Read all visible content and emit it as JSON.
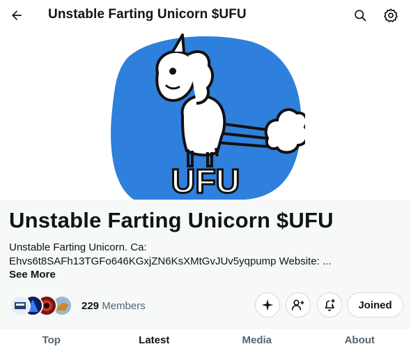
{
  "header": {
    "title": "Unstable Farting Unicorn $UFU",
    "icons": [
      "arrow-left-icon",
      "search-icon",
      "gear-icon"
    ]
  },
  "banner": {
    "logo_text": "UFU",
    "background_color": "#2f7fdc"
  },
  "community": {
    "name": "Unstable Farting Unicorn $UFU",
    "description_line1": "Unstable Farting Unicorn. Ca:",
    "description_line2": "Ehvs6t8SAFh13TGFo646KGxjZN6KsXMtGvJUv5yqpump Website: ...",
    "see_more": "See More",
    "member_count": "229",
    "members_label": "Members",
    "actions": {
      "sparkle": "sparkle-icon",
      "invite": "add-person-icon",
      "notifications": "bell-plus-icon",
      "joined_label": "Joined"
    }
  },
  "tabs": [
    {
      "label": "Top",
      "active": false
    },
    {
      "label": "Latest",
      "active": true
    },
    {
      "label": "Media",
      "active": false
    },
    {
      "label": "About",
      "active": false
    }
  ],
  "colors": {
    "text": "#0f1419",
    "secondary_text": "#536471",
    "border": "#cfd9de",
    "panel": "#f7f9f9"
  }
}
